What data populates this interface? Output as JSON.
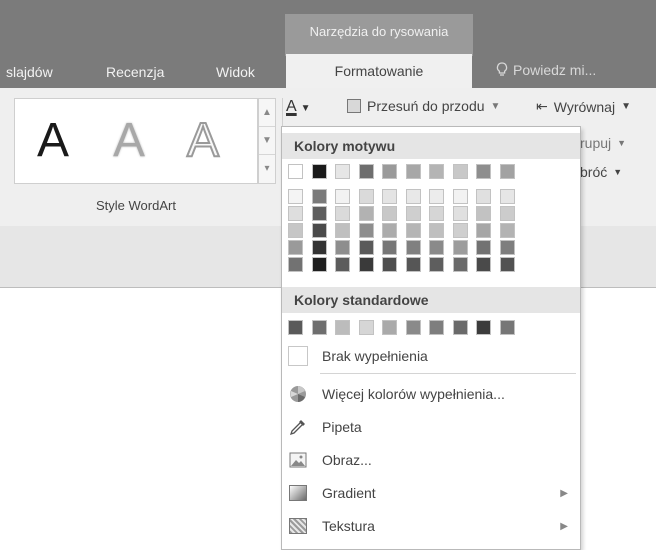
{
  "tabs": {
    "context_header": "Narzędzia do rysowania",
    "items": [
      {
        "label": "slajdów"
      },
      {
        "label": "Recenzja"
      },
      {
        "label": "Widok"
      }
    ],
    "active": "Formatowanie",
    "tell_me": "Powiedz mi..."
  },
  "ribbon": {
    "wordart_letter": "A",
    "wordart_group_label": "Style WordArt",
    "bring_forward": "Przesuń do przodu",
    "align": "Wyrównaj",
    "group_partial": "rupuj",
    "rotate_partial": "bróć"
  },
  "dropdown": {
    "theme_colors_header": "Kolory motywu",
    "standard_colors_header": "Kolory standardowe",
    "theme_top_row": [
      "#ffffff",
      "#1a1a1a",
      "#e6e6e6",
      "#6e6e6e",
      "#9a9a9a",
      "#a7a7a7",
      "#b4b4b4",
      "#c8c8c8",
      "#8e8e8e",
      "#a2a2a2"
    ],
    "theme_shades": [
      [
        "#f4f4f4",
        "#7a7a7a",
        "#f2f2f2",
        "#dadada",
        "#e4e4e4",
        "#e8e8e8",
        "#ececec",
        "#f2f2f2",
        "#e0e0e0",
        "#e6e6e6"
      ],
      [
        "#dedede",
        "#5e5e5e",
        "#dadada",
        "#b2b2b2",
        "#c8c8c8",
        "#cfcfcf",
        "#d6d6d6",
        "#e0e0e0",
        "#c2c2c2",
        "#cccccc"
      ],
      [
        "#c6c6c6",
        "#4a4a4a",
        "#bfbfbf",
        "#8e8e8e",
        "#acacac",
        "#b5b5b5",
        "#bfbfbf",
        "#cfcfcf",
        "#a6a6a6",
        "#b3b3b3"
      ],
      [
        "#9a9a9a",
        "#333333",
        "#8e8e8e",
        "#5a5a5a",
        "#767676",
        "#808080",
        "#8a8a8a",
        "#9c9c9c",
        "#727272",
        "#7e7e7e"
      ],
      [
        "#727272",
        "#1f1f1f",
        "#5c5c5c",
        "#3a3a3a",
        "#4e4e4e",
        "#565656",
        "#5e5e5e",
        "#6a6a6a",
        "#4a4a4a",
        "#525252"
      ]
    ],
    "standard_colors": [
      "#5a5a5a",
      "#6e6e6e",
      "#bcbcbc",
      "#d6d6d6",
      "#aaaaaa",
      "#8a8a8a",
      "#7e7e7e",
      "#6a6a6a",
      "#3c3c3c",
      "#767676"
    ],
    "no_fill": "Brak wypełnienia",
    "more_colors": "Więcej kolorów wypełnienia...",
    "eyedropper": "Pipeta",
    "picture": "Obraz...",
    "gradient": "Gradient",
    "texture": "Tekstura"
  }
}
